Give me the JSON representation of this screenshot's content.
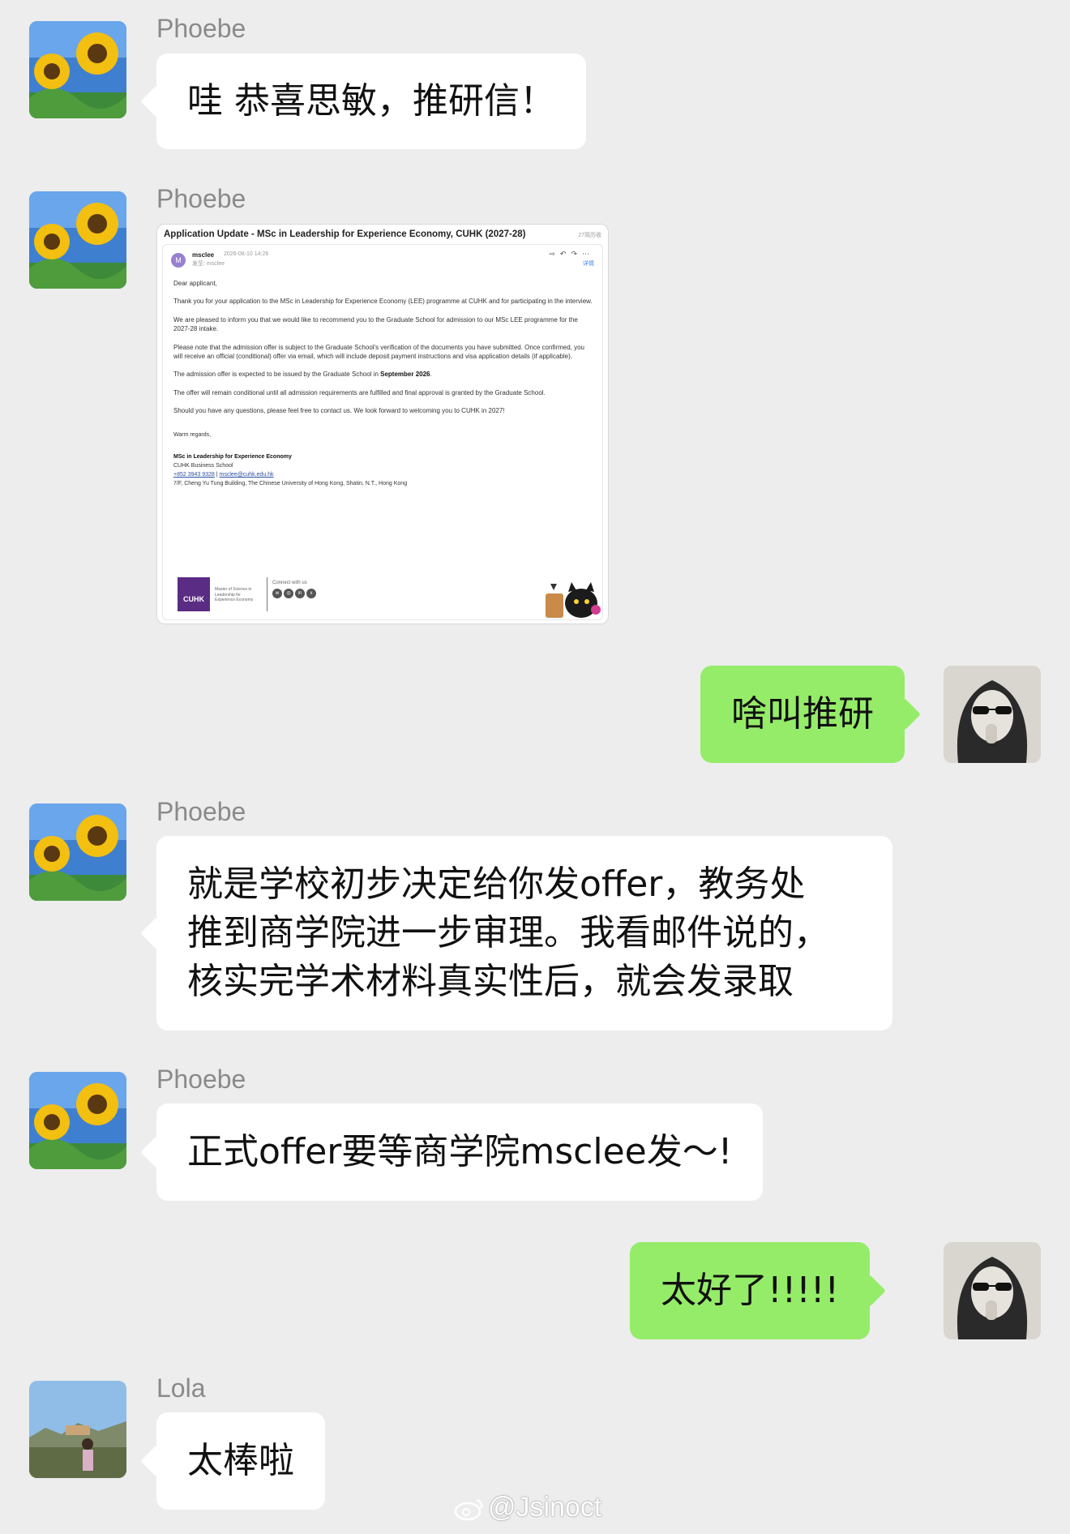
{
  "messages": [
    {
      "type": "text",
      "direction": "in",
      "sender": "Phoebe",
      "text": "哇 恭喜思敏，推研信！"
    },
    {
      "type": "email",
      "direction": "in",
      "sender": "Phoebe"
    },
    {
      "type": "text",
      "direction": "out",
      "text": "啥叫推研"
    },
    {
      "type": "text",
      "direction": "in",
      "sender": "Phoebe",
      "text": "就是学校初步决定给你发offer，教务处\n推到商学院进一步审理。我看邮件说的，\n核实完学术材料真实性后，就会发录取"
    },
    {
      "type": "text",
      "direction": "in",
      "sender": "Phoebe",
      "text": "正式offer要等商学院msclee发～!"
    },
    {
      "type": "text",
      "direction": "out",
      "text": "太好了!!!!!"
    },
    {
      "type": "text",
      "direction": "in",
      "sender": "Lola",
      "text": "太棒啦"
    }
  ],
  "email": {
    "subject": "Application Update - MSc in Leadership for Experience Economy, CUHK (2027-28)",
    "note": "27简历收",
    "avatar_letter": "M",
    "from": "msclee",
    "date": "2026-08-10 14:26",
    "to": "发至: msclee",
    "detail_link": "详情",
    "greeting": "Dear applicant,",
    "para1": "Thank you for your application to the MSc in Leadership for Experience Economy (LEE) programme at CUHK and for participating in the interview.",
    "para2": "We are pleased to inform you that we would like to recommend you to the Graduate School for admission to our MSc LEE programme for the 2027-28 intake.",
    "para3": "Please note that the admission offer is subject to the Graduate School's verification of the documents you have submitted. Once confirmed, you will receive an official (conditional) offer via email, which will include deposit payment instructions and visa application details (if applicable).",
    "para4_pre": "The admission offer is expected to be issued by the Graduate School in ",
    "para4_bold": "September 2026",
    "para4_post": ".",
    "para5": "The offer will remain conditional until all admission requirements are fulfilled and final approval is granted by the Graduate School.",
    "para6": "Should you have any questions, please feel free to contact us. We look forward to welcoming you to CUHK in 2027!",
    "closing": "Warm regards,",
    "sig_name": "MSc in Leadership for Experience Economy",
    "sig_school": "CUHK Business School",
    "sig_phone": "+852 3943 9328",
    "sig_sep": " | ",
    "sig_email": "msclee@cuhk.edu.hk",
    "sig_address": "7/F, Cheng Yu Tung Building, The Chinese University of Hong Kong, Shatin, N.T., Hong Kong",
    "logo_text": "CUHK",
    "logo_subtext": "Master of Science in Leadership for Experience Economy",
    "connect_label": "Connect with us",
    "social_icons": [
      "wechat-icon",
      "instagram-icon",
      "linkedin-icon",
      "xhs-icon"
    ]
  },
  "watermark": "@Jsinoct",
  "colors": {
    "background": "#ededed",
    "incoming_bubble": "#ffffff",
    "outgoing_bubble": "#95ec69",
    "sender_name": "#8a8a8a"
  }
}
